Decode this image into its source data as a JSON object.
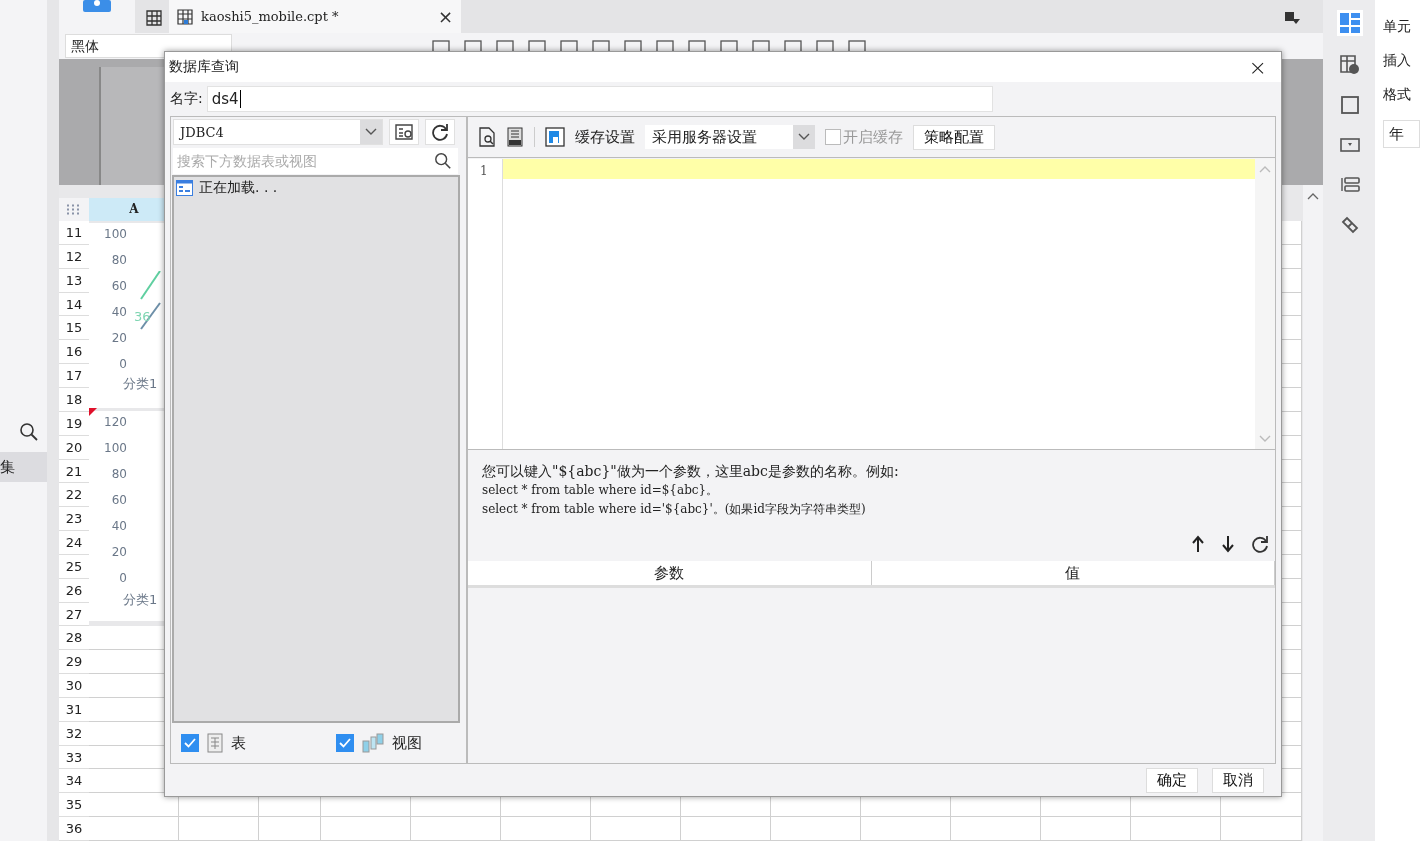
{
  "app": {
    "tab": {
      "title": "kaoshi5_mobile.cpt *",
      "close": "×"
    },
    "font_field": {
      "value": "黑体"
    },
    "left_panel": {
      "label": "集"
    },
    "sheet": {
      "column_header": "A",
      "rows": [
        "11",
        "12",
        "13",
        "14",
        "15",
        "16",
        "17",
        "18",
        "19",
        "20",
        "21",
        "22",
        "23",
        "24",
        "25",
        "26",
        "27",
        "28",
        "29",
        "30",
        "31",
        "32",
        "33",
        "34",
        "35",
        "36"
      ],
      "charts": [
        {
          "ticks": [
            "100",
            "80",
            "60",
            "40",
            "20",
            "0"
          ],
          "data_label": "36",
          "category": "分类1"
        },
        {
          "ticks": [
            "120",
            "100",
            "80",
            "60",
            "40",
            "20",
            "0"
          ],
          "category": "分类1"
        }
      ]
    },
    "right_panel": {
      "items": [
        "单元",
        "插入",
        "格式"
      ],
      "field_value": "年"
    }
  },
  "dialog": {
    "title": "数据库查询",
    "close": "×",
    "name_label": "名字:",
    "name_value": "ds4",
    "connection": "JDBC4",
    "search_placeholder": "搜索下方数据表或视图",
    "tree_items": [
      {
        "label": "正在加载. . ."
      }
    ],
    "filters": [
      {
        "label": "表",
        "checked": true,
        "kind": "table"
      },
      {
        "label": "视图",
        "checked": true,
        "kind": "view"
      }
    ],
    "cache_label": "缓存设置",
    "cache_mode": "采用服务器设置",
    "enable_cache": {
      "label": "开启缓存",
      "checked": false,
      "disabled": true
    },
    "strategy_button": "策略配置",
    "editor": {
      "line_numbers": [
        "1"
      ]
    },
    "hint": [
      "您可以键入\"${abc}\"做为一个参数，这里abc是参数的名称。例如:",
      "select * from table where id=${abc}。",
      "select * from table where id='${abc}'。(如果id字段为字符串类型)"
    ],
    "params_table": {
      "columns": [
        "参数",
        "值"
      ]
    },
    "buttons": [
      "确定",
      "取消"
    ]
  }
}
